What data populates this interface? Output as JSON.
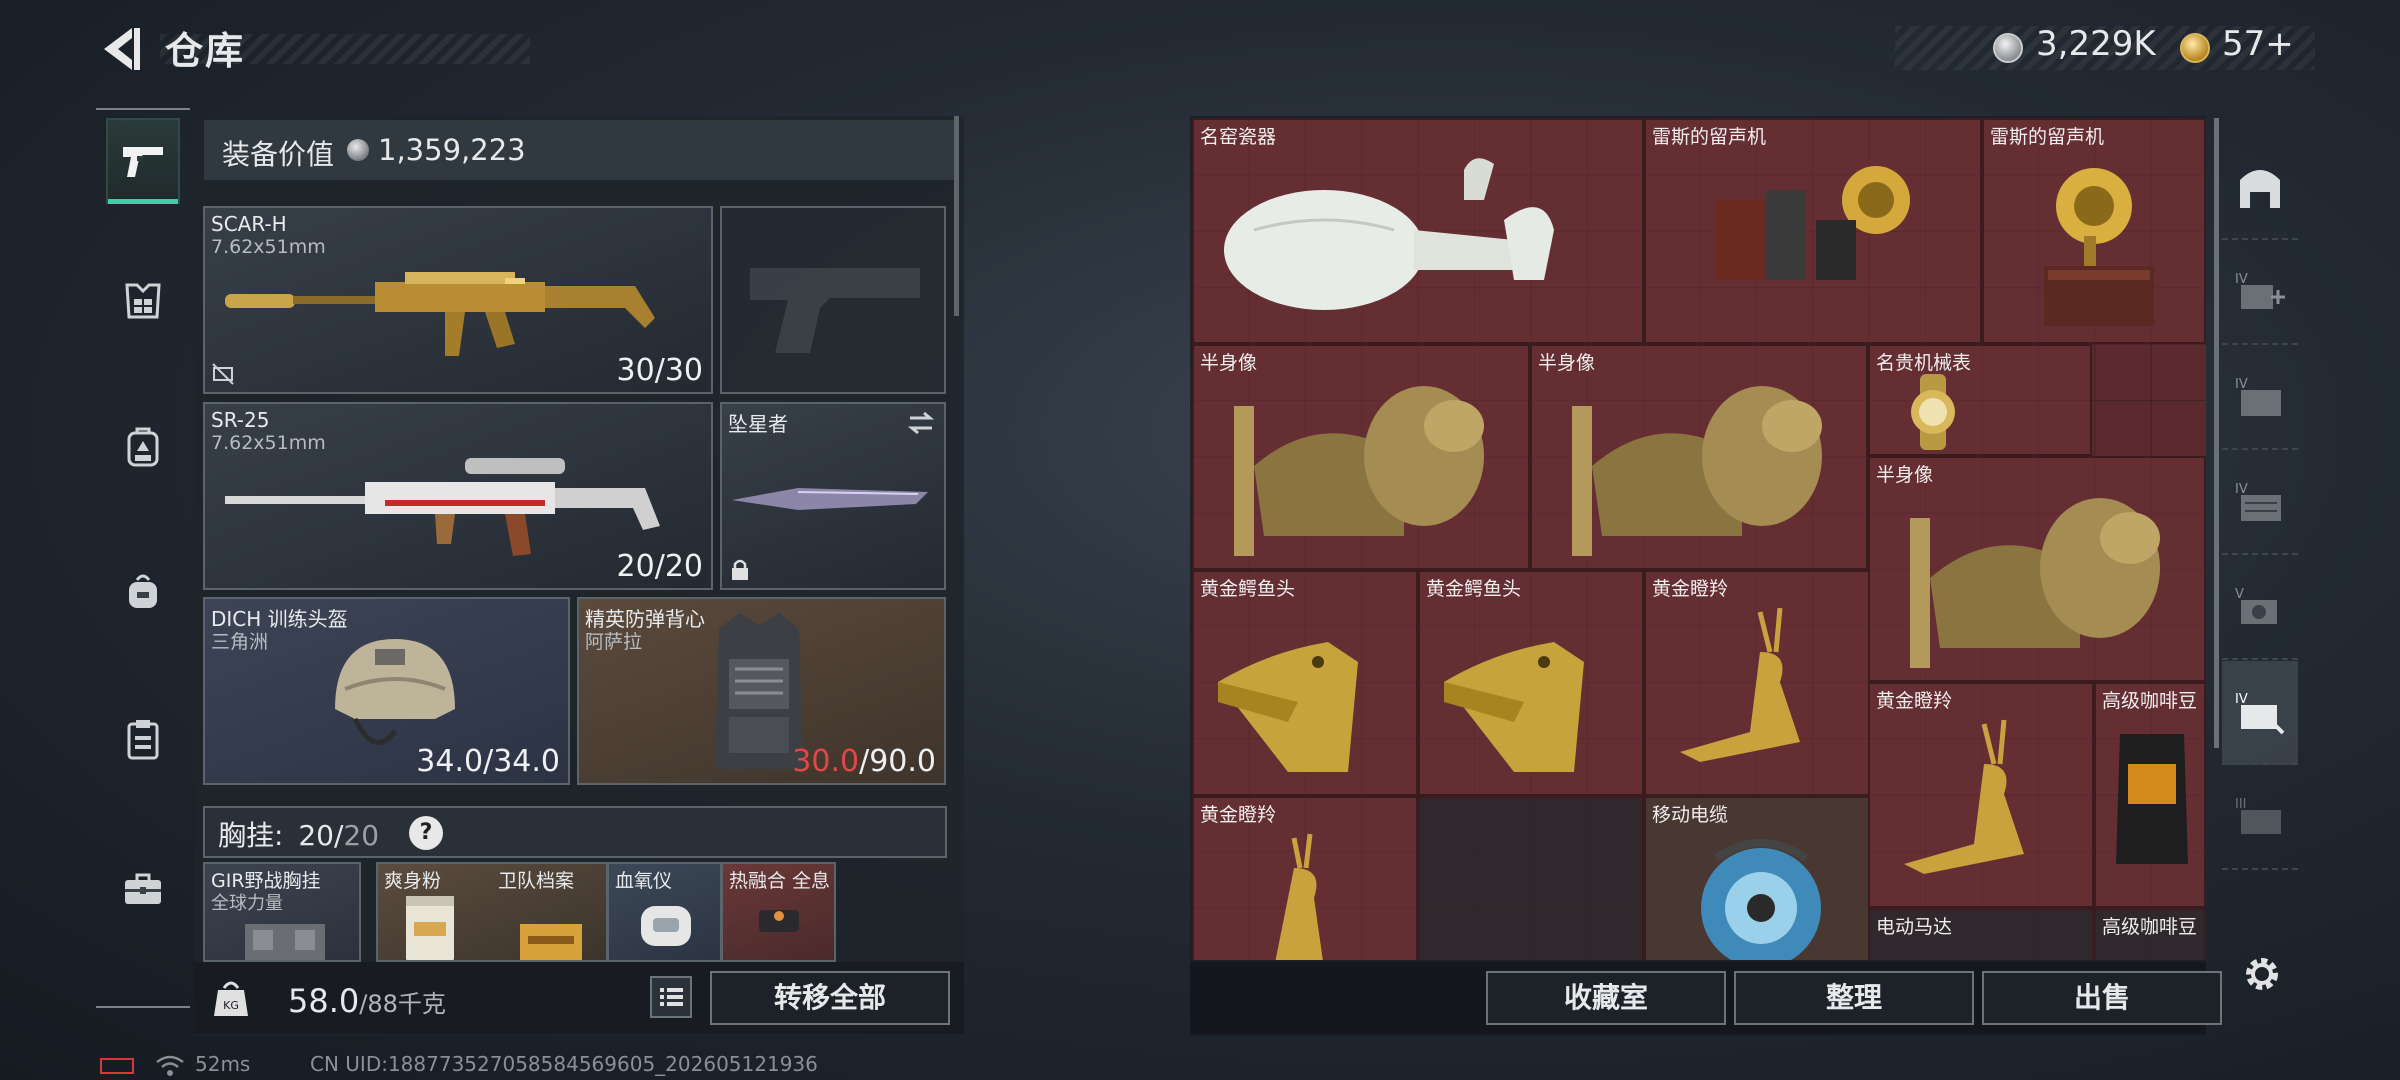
{
  "header": {
    "title": "仓库",
    "currency_silver": "3,229K",
    "currency_gold": "57+"
  },
  "left_rail": {
    "items": [
      "pistol-icon",
      "armor-icon",
      "backpack-icon",
      "bag-icon",
      "clipboard-icon",
      "toolbox-icon"
    ]
  },
  "equipment": {
    "value_label": "装备价值",
    "value": "1,359,223",
    "primary_weapon": {
      "name": "SCAR-H",
      "ammo": "7.62x51mm",
      "count": "30/30"
    },
    "secondary_weapon": {
      "name": "SR-25",
      "ammo": "7.62x51mm",
      "count": "20/20"
    },
    "melee": {
      "name": "坠星者"
    },
    "helmet": {
      "name": "DICH 训练头盔",
      "sub": "三角洲",
      "durability": "34.0/34.0"
    },
    "vest": {
      "name": "精英防弹背心",
      "sub": "阿萨拉",
      "durability_current": "30.0",
      "durability_max": "/90.0",
      "durability_current_color": "#e04848"
    },
    "chest_rig": {
      "label": "胸挂:",
      "capacity_current": "20/",
      "capacity_max": "20",
      "help": "?"
    },
    "rig_item": {
      "name": "GIR野战胸挂",
      "sub": "全球力量"
    },
    "pouch_items": [
      {
        "name": "爽身粉"
      },
      {
        "name": "卫队档案"
      },
      {
        "name": "血氧仪"
      },
      {
        "name": "热融合 全息"
      }
    ],
    "weight_current": "58.0",
    "weight_max": "/88千克",
    "transfer_all": "转移全部"
  },
  "storage": {
    "items": [
      {
        "name": "名窑瓷器"
      },
      {
        "name": "雷斯的留声机"
      },
      {
        "name": "雷斯的留声机"
      },
      {
        "name": "半身像"
      },
      {
        "name": "半身像"
      },
      {
        "name": "名贵机械表"
      },
      {
        "name": "半身像"
      },
      {
        "name": "黄金鳄鱼头"
      },
      {
        "name": "黄金鳄鱼头"
      },
      {
        "name": "黄金瞪羚"
      },
      {
        "name": "黄金瞪羚"
      },
      {
        "name": "高级咖啡豆"
      },
      {
        "name": "黄金瞪羚"
      },
      {
        "name": "移动电缆"
      },
      {
        "name": "电动马达"
      },
      {
        "name": "高级咖啡豆"
      }
    ],
    "buttons": {
      "collection": "收藏室",
      "sort": "整理",
      "sell": "出售"
    }
  },
  "right_rail": {
    "items": [
      "safe-house-icon",
      "container-iv-add-icon",
      "container-iv-icon",
      "container-iv-2-icon",
      "container-v-icon",
      "container-iv-active-icon",
      "container-iii-icon"
    ]
  },
  "status": {
    "ping": "52ms",
    "uid": "CN UID:188773527058584569605_202605121936"
  }
}
